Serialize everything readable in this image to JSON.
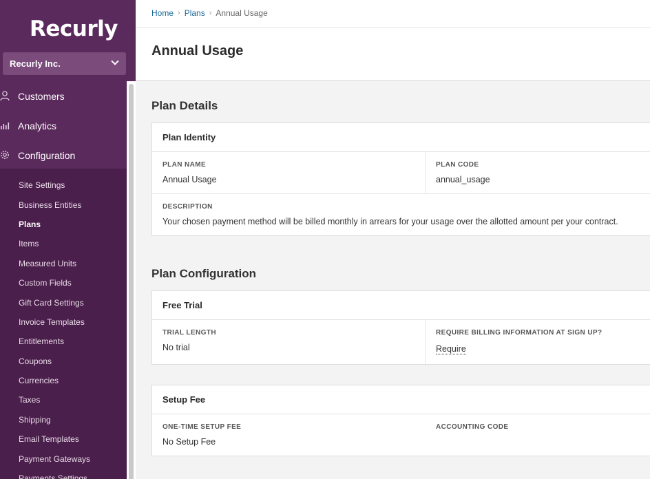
{
  "brand": {
    "logo_text": "Recurly",
    "accent": "#5b2a5c"
  },
  "account": {
    "name": "Recurly Inc."
  },
  "nav_main": [
    {
      "label": "Customers",
      "icon": "person-icon"
    },
    {
      "label": "Analytics",
      "icon": "bar-chart-icon"
    },
    {
      "label": "Configuration",
      "icon": "gear-icon"
    }
  ],
  "nav_sub": [
    {
      "label": "Site Settings",
      "active": false
    },
    {
      "label": "Business Entities",
      "active": false
    },
    {
      "label": "Plans",
      "active": true
    },
    {
      "label": "Items",
      "active": false
    },
    {
      "label": "Measured Units",
      "active": false
    },
    {
      "label": "Custom Fields",
      "active": false
    },
    {
      "label": "Gift Card Settings",
      "active": false
    },
    {
      "label": "Invoice Templates",
      "active": false
    },
    {
      "label": "Entitlements",
      "active": false
    },
    {
      "label": "Coupons",
      "active": false
    },
    {
      "label": "Currencies",
      "active": false
    },
    {
      "label": "Taxes",
      "active": false
    },
    {
      "label": "Shipping",
      "active": false
    },
    {
      "label": "Email Templates",
      "active": false
    },
    {
      "label": "Payment Gateways",
      "active": false
    },
    {
      "label": "Payments Settings",
      "active": false
    }
  ],
  "breadcrumb": {
    "home": "Home",
    "plans": "Plans",
    "current": "Annual Usage",
    "separator": "›"
  },
  "page": {
    "title": "Annual Usage"
  },
  "plan_details": {
    "title": "Plan Details",
    "identity_header": "Plan Identity",
    "plan_name_label": "PLAN NAME",
    "plan_name": "Annual Usage",
    "plan_code_label": "PLAN CODE",
    "plan_code": "annual_usage",
    "description_label": "DESCRIPTION",
    "description": "Your chosen payment method will be billed monthly in arrears for your usage over the allotted amount per your contract."
  },
  "plan_configuration": {
    "title": "Plan Configuration",
    "free_trial_header": "Free Trial",
    "trial_length_label": "TRIAL LENGTH",
    "trial_length": "No trial",
    "require_billing_label": "REQUIRE BILLING INFORMATION AT SIGN UP?",
    "require_billing": "Require",
    "setup_fee_header": "Setup Fee",
    "setup_fee_label": "ONE-TIME SETUP FEE",
    "setup_fee": "No Setup Fee",
    "accounting_code_label": "ACCOUNTING CODE",
    "accounting_code": ""
  }
}
